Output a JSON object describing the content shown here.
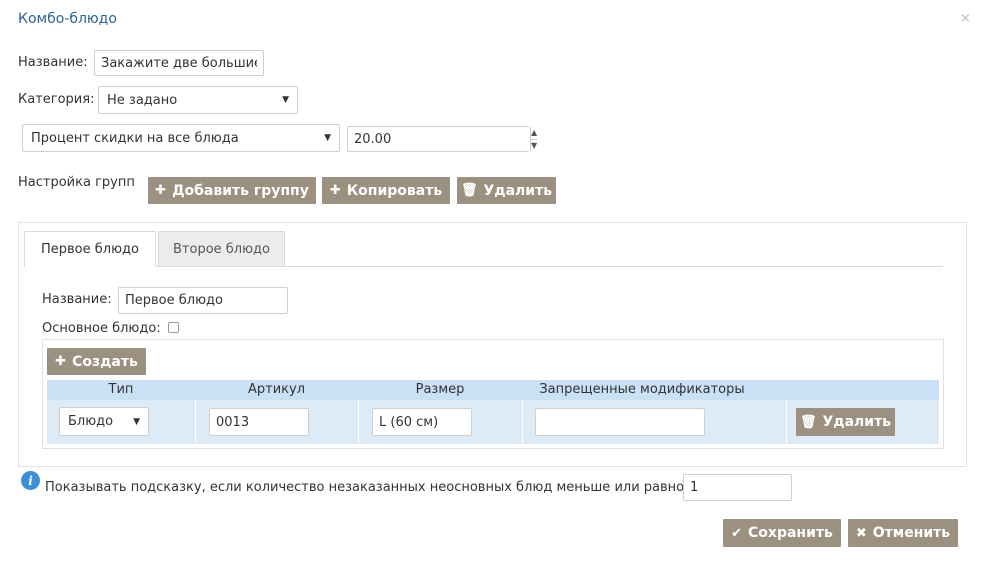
{
  "dialog": {
    "title": "Комбо-блюдо",
    "close_icon": "×"
  },
  "form": {
    "name_label": "Название:",
    "name_value": "Закажите две большие",
    "category_label": "Категория:",
    "category_value": "Не задано",
    "discount_type_value": "Процент скидки на все блюда",
    "discount_amount_value": "20.00"
  },
  "groups": {
    "label": "Настройка групп",
    "add_label": "Добавить группу",
    "copy_label": "Копировать",
    "delete_label": "Удалить"
  },
  "tabs": [
    {
      "label": "Первое блюдо",
      "active": true
    },
    {
      "label": "Второе блюдо",
      "active": false
    }
  ],
  "group_form": {
    "name_label": "Название:",
    "name_value": "Первое блюдо",
    "main_dish_label": "Основное блюдо:",
    "main_dish_checked": false
  },
  "table": {
    "create_label": "Создать",
    "columns": [
      "Тип",
      "Артикул",
      "Размер",
      "Запрещенные модификаторы"
    ],
    "rows": [
      {
        "type": "Блюдо",
        "article": "0013",
        "size": "L (60 см)",
        "modifiers": "",
        "delete_label": "Удалить"
      }
    ]
  },
  "hint": {
    "label": "Показывать подсказку, если количество незаказанных неосновных блюд меньше или равно",
    "value": "1"
  },
  "footer": {
    "save_label": "Сохранить",
    "cancel_label": "Отменить"
  },
  "colors": {
    "title": "#2a6496",
    "button": "#9c9181",
    "table_header": "#c9e0f5",
    "table_row": "#ddebf7",
    "info_icon": "#3d8fd6"
  }
}
